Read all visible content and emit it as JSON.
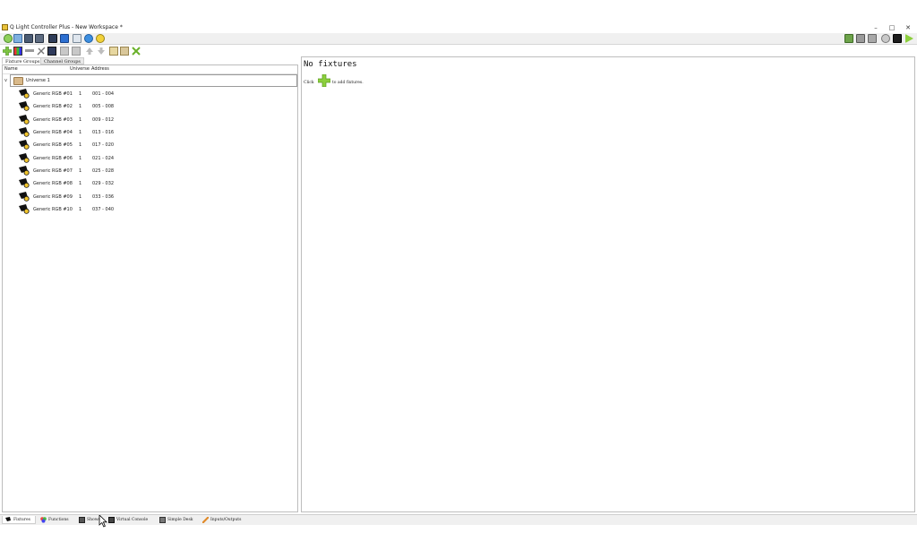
{
  "window": {
    "title": "Q Light Controller Plus - New Workspace *",
    "controls": [
      "–",
      "□",
      "✕"
    ]
  },
  "colors": {
    "toolbar_bg": "#f0f0f0",
    "accent_green": "#7cc341",
    "panel_border": "#bdbdbd"
  },
  "main_toolbar": {
    "left_icons": [
      "new-workspace-icon",
      "open-workspace-icon",
      "save-workspace-icon",
      "save-as-icon",
      "monitor-icon",
      "address-tool-icon",
      "fullscreen-icon",
      "help-icon",
      "about-icon"
    ],
    "right_icons": [
      "dmx-dump-icon",
      "live-edit-icon",
      "blackout-icon",
      "stop-all-icon",
      "audio-input-icon",
      "operate-mode-icon"
    ]
  },
  "fixture_toolbar": {
    "icons": [
      "add-fixture-icon",
      "add-rgb-panel-icon",
      "remove-fixture-icon",
      "properties-icon",
      "fade-config-icon",
      "group-icon",
      "ungroup-icon",
      "move-up-icon",
      "move-down-icon",
      "import-icon",
      "export-icon",
      "remap-icon"
    ]
  },
  "subtabs": [
    "Fixture Groups",
    "Channel Groups"
  ],
  "tree": {
    "columns": {
      "name": "Name",
      "universe": "Universe",
      "address": "Address"
    },
    "universe_label": "Universe 1",
    "expander": "v",
    "fixtures": [
      {
        "name": "Generic RGB #01",
        "universe": "1",
        "address": "001 - 004"
      },
      {
        "name": "Generic RGB #02",
        "universe": "1",
        "address": "005 - 008"
      },
      {
        "name": "Generic RGB #03",
        "universe": "1",
        "address": "009 - 012"
      },
      {
        "name": "Generic RGB #04",
        "universe": "1",
        "address": "013 - 016"
      },
      {
        "name": "Generic RGB #05",
        "universe": "1",
        "address": "017 - 020"
      },
      {
        "name": "Generic RGB #06",
        "universe": "1",
        "address": "021 - 024"
      },
      {
        "name": "Generic RGB #07",
        "universe": "1",
        "address": "025 - 028"
      },
      {
        "name": "Generic RGB #08",
        "universe": "1",
        "address": "029 - 032"
      },
      {
        "name": "Generic RGB #09",
        "universe": "1",
        "address": "033 - 036"
      },
      {
        "name": "Generic RGB #10",
        "universe": "1",
        "address": "037 - 040"
      }
    ]
  },
  "right_panel": {
    "title": "No fixtures",
    "hint_prefix": "Click",
    "hint_suffix": "to add fixtures."
  },
  "bottom_tabs": [
    {
      "label": "Fixtures",
      "icon": "fixtures-icon",
      "active": true
    },
    {
      "label": "Functions",
      "icon": "functions-icon",
      "active": false
    },
    {
      "label": "Shows",
      "icon": "shows-icon",
      "active": false
    },
    {
      "label": "Virtual Console",
      "icon": "virtual-console-icon",
      "active": false
    },
    {
      "label": "Simple Desk",
      "icon": "simple-desk-icon",
      "active": false
    },
    {
      "label": "Inputs/Outputs",
      "icon": "inputs-outputs-icon",
      "active": false
    }
  ]
}
